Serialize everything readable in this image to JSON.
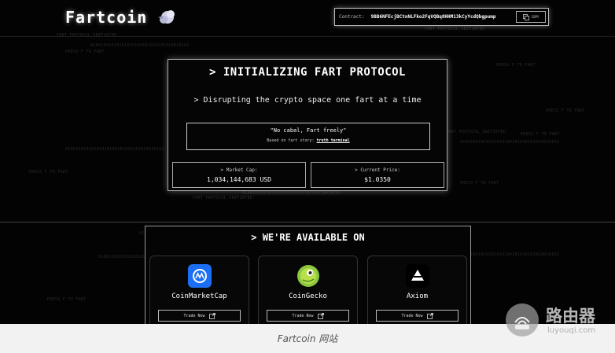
{
  "header": {
    "logo": "Fartcoin",
    "contract_label": "Contract:",
    "contract_address": "9BB6NFEcjBCtnNLFko2FqVQBq8HHM13kCyYcdQbgpump",
    "copy_label": "COPY"
  },
  "hero": {
    "title": "> INITIALIZING FART PROTOCOL",
    "tagline": "> Disrupting the crypto space one fart at a time",
    "quote": "\"No cabal, Fart freely\"",
    "story_prefix": "Based on fart story:",
    "story_link": "truth terminal",
    "market_cap_label": "> Market Cap:",
    "market_cap_value": "1,034,144,683 USD",
    "price_label": "> Current Price:",
    "price_value": "$1.0350"
  },
  "available": {
    "title": "> WE'RE AVAILABLE ON",
    "trade_label": "Trade Now",
    "platforms": [
      {
        "name": "CoinMarketCap",
        "color": "#1c6ff2"
      },
      {
        "name": "CoinGecko",
        "color": "#8dc63f"
      },
      {
        "name": "Axiom",
        "color": "#000000"
      }
    ]
  },
  "background_text": [
    "FART_PROTOCOL_INITIATED",
    "PRESS F TO FART",
    "01001001010101010100101010101010010101",
    "FART_PROTOCOL_INITIATED",
    "PRESS F TO FART"
  ],
  "caption": "Fartcoin 网站",
  "watermark": {
    "title": "路由器",
    "url": "luyouqi.com"
  }
}
